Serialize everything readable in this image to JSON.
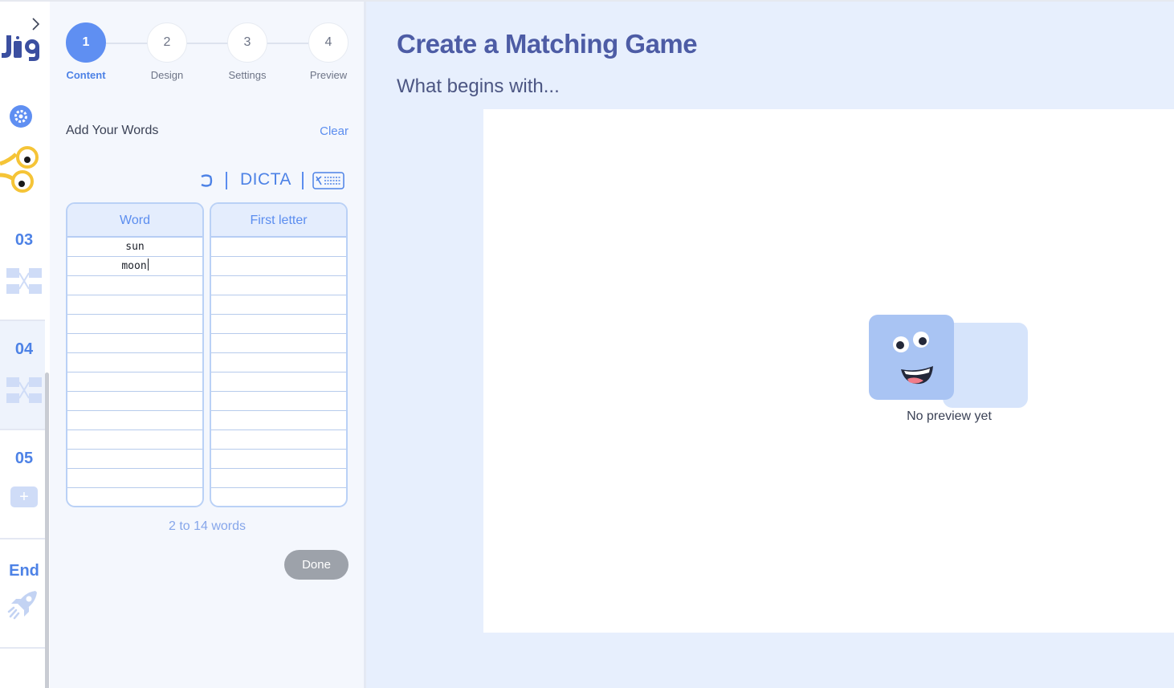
{
  "stepper": {
    "steps": [
      {
        "number": "1",
        "label": "Content"
      },
      {
        "number": "2",
        "label": "Design"
      },
      {
        "number": "3",
        "label": "Settings"
      },
      {
        "number": "4",
        "label": "Preview"
      }
    ],
    "active_step": 1
  },
  "rail": {
    "slides": [
      {
        "label": "03"
      },
      {
        "label": "04"
      },
      {
        "label": "05"
      }
    ],
    "end_label": "End",
    "add_label": "+"
  },
  "editor": {
    "heading": "Add Your Words",
    "clear_label": "Clear",
    "dicta_label": "DICTA",
    "columns": [
      "Word",
      "First letter"
    ],
    "rows": [
      [
        "sun",
        ""
      ],
      [
        "moon",
        ""
      ],
      [
        "",
        ""
      ],
      [
        "",
        ""
      ],
      [
        "",
        ""
      ],
      [
        "",
        ""
      ],
      [
        "",
        ""
      ],
      [
        "",
        ""
      ],
      [
        "",
        ""
      ],
      [
        "",
        ""
      ],
      [
        "",
        ""
      ],
      [
        "",
        ""
      ],
      [
        "",
        ""
      ],
      [
        "",
        ""
      ]
    ],
    "hint": "2 to 14 words",
    "done_label": "Done"
  },
  "preview": {
    "title": "Create a Matching Game",
    "subtitle": "What begins with...",
    "empty_text": "No preview yet"
  },
  "colors": {
    "accent": "#5f8ff2",
    "title": "#4d5ca5",
    "preview_bg": "#e7effd"
  }
}
